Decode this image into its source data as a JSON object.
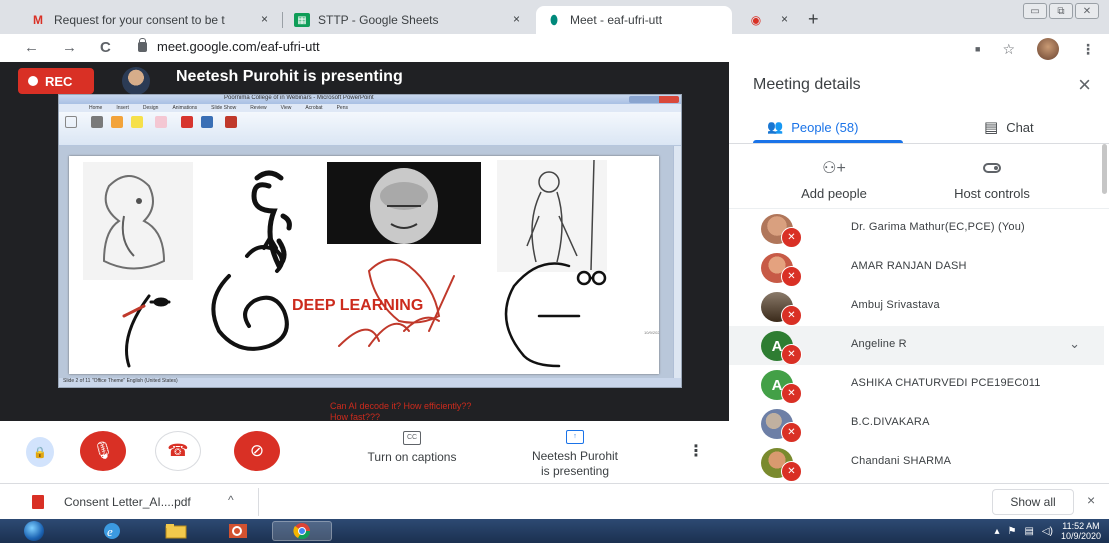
{
  "browser": {
    "tabs": [
      {
        "title": "Request for your consent to be t",
        "favicon": "gmail-icon",
        "favicon_glyph": "M"
      },
      {
        "title": "STTP - Google Sheets",
        "favicon": "sheets-icon",
        "favicon_glyph": "▦"
      },
      {
        "title": "Meet - eaf-ufri-utt",
        "favicon": "meet-icon",
        "favicon_glyph": "⬮",
        "active": true
      },
      {
        "title": "",
        "favicon": "recording-icon",
        "favicon_glyph": "◉"
      }
    ],
    "close_glyph": "×",
    "new_tab_glyph": "+",
    "window_controls": [
      "▭",
      "⧉",
      "✕"
    ],
    "url": "meet.google.com/eaf-ufri-utt",
    "nav": {
      "back": "←",
      "forward": "→",
      "reload": "C"
    },
    "addr_icons": {
      "camera": "■",
      "star": "☆",
      "menu": "⋮"
    }
  },
  "meeting": {
    "rec_label": "REC",
    "presenting_title": "Neetesh Purohit is presenting",
    "slide": {
      "window_title": "Poornima College of in Webinars - Microsoft PowerPoint",
      "menu_items": [
        "Home",
        "Insert",
        "Design",
        "Animations",
        "Slide Show",
        "Review",
        "View",
        "Acrobat",
        "Pens"
      ],
      "heading": "DEEP LEARNING",
      "caption_line1": "Can AI decode it? How efficiently??",
      "caption_line2": "How fast???",
      "status": "Slide 2 of 11   \"Office Theme\"   English (United States)"
    },
    "controls": {
      "mic_glyph": "🎙",
      "hangup_glyph": "☎",
      "camera_glyph": "⊘",
      "captions_glyph": "CC",
      "captions_label": "Turn on captions",
      "present_glyph": "↑",
      "present_label_1": "Neetesh Purohit",
      "present_label_2": "is presenting",
      "more_glyph": "⋮",
      "shield_glyph": "🔒"
    }
  },
  "panel": {
    "title": "Meeting details",
    "close_glyph": "×",
    "tabs": {
      "people": "People (58)",
      "chat": "Chat"
    },
    "people_icon": "👥",
    "chat_icon": "▤",
    "actions": {
      "add": "Add people",
      "host": "Host controls",
      "add_icon": "⚇+"
    },
    "participants": [
      {
        "name": "Dr. Garima Mathur(EC,PCE) (You)",
        "avatar": "photo",
        "color": "#b0765a"
      },
      {
        "name": "AMAR RANJAN DASH",
        "avatar": "photo",
        "color": "#c75a46"
      },
      {
        "name": "Ambuj Srivastava",
        "avatar": "photo",
        "color": "#5a4a3a"
      },
      {
        "name": "Angeline R",
        "avatar": "A",
        "color": "#2e7d32",
        "expanded": true
      },
      {
        "name": "ASHIKA CHATURVEDI PCE19EC011",
        "avatar": "A",
        "color": "#43a047"
      },
      {
        "name": "B.C.DIVAKARA",
        "avatar": "photo",
        "color": "#6d7fa6"
      },
      {
        "name": "Chandani SHARMA",
        "avatar": "photo",
        "color": "#7a8a2e"
      }
    ],
    "mute_glyph": "✕",
    "chevron_glyph": "⌄"
  },
  "downloads": {
    "file": "Consent Letter_AI....pdf",
    "caret": "^",
    "show_all": "Show all",
    "close": "×"
  },
  "taskbar": {
    "time": "11:52 AM",
    "date": "10/9/2020",
    "apps": [
      "ie-icon",
      "explorer-icon",
      "powerpoint-icon",
      "chrome-icon"
    ]
  }
}
